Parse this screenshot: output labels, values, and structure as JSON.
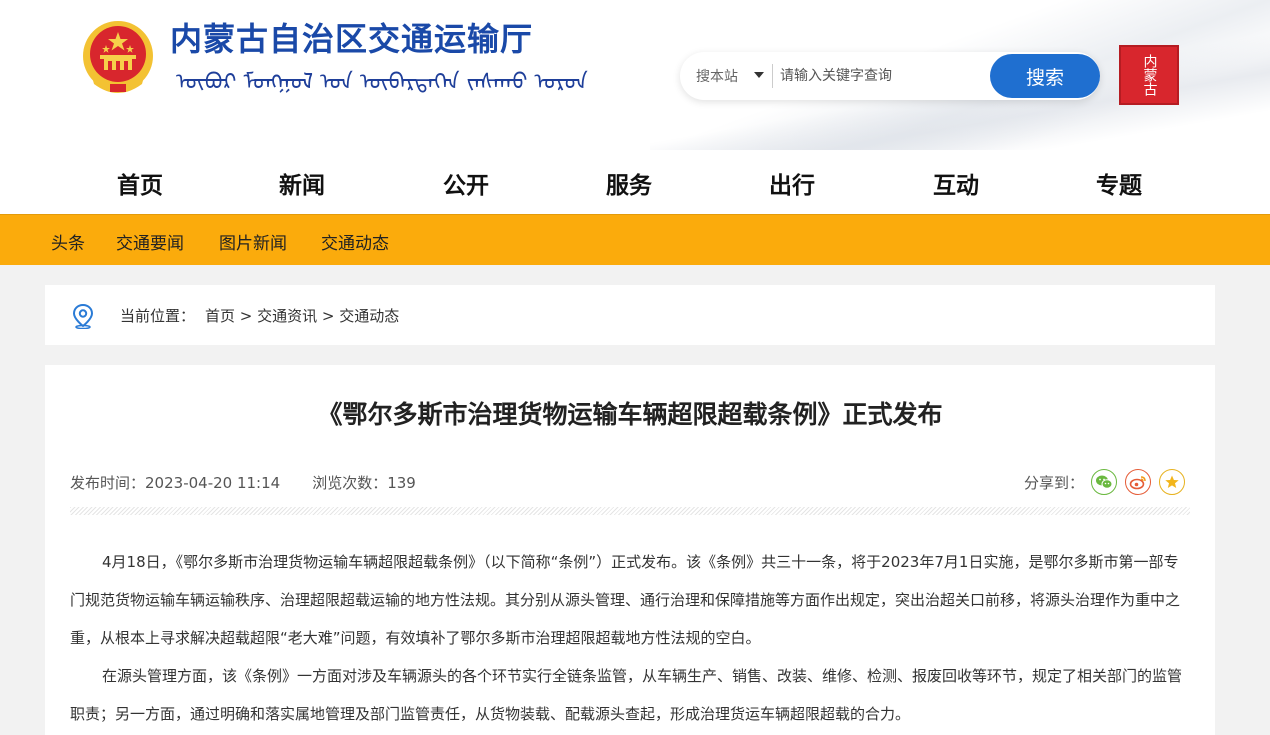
{
  "header": {
    "site_title": "内蒙古自治区交通运输厅",
    "mongolian_title": "ᠥᠪᠦᠷ ᠮᠣᠩᠭᠣᠯ ᠤᠨ ᠥᠪᠡᠷᠲᠡᠭᠡᠨ ᠵᠠᠰᠠᠬᠤ ᠣᠷᠤᠨ",
    "seal_text": "内蒙古",
    "colors": {
      "title": "#1a49a8",
      "search_button": "#1f6fd0",
      "seal": "#d8262d"
    }
  },
  "search": {
    "scope_label": "搜本站",
    "placeholder": "请输入关键字查询",
    "button_label": "搜索"
  },
  "main_nav": {
    "items": [
      "首页",
      "新闻",
      "公开",
      "服务",
      "出行",
      "互动",
      "专题"
    ]
  },
  "sub_nav": {
    "items": [
      "头条",
      "交通要闻",
      "图片新闻",
      "交通动态"
    ],
    "background": "#fbab0c"
  },
  "breadcrumb": {
    "label": "当前位置：",
    "items": [
      "首页",
      "交通资讯",
      "交通动态"
    ],
    "separator": " > "
  },
  "article": {
    "title": "《鄂尔多斯市治理货物运输车辆超限超载条例》正式发布",
    "publish_label": "发布时间：",
    "publish_time": "2023-04-20 11:14",
    "views_label": "浏览次数：",
    "views": "139",
    "share_label": "分享到：",
    "share_icons": [
      "wechat-icon",
      "weibo-icon",
      "favorite-star-icon"
    ],
    "paragraphs": [
      "4月18日，《鄂尔多斯市治理货物运输车辆超限超载条例》（以下简称“条例”）正式发布。该《条例》共三十一条，将于2023年7月1日实施，是鄂尔多斯市第一部专门规范货物运输车辆运输秩序、治理超限超载运输的地方性法规。其分别从源头管理、通行治理和保障措施等方面作出规定，突出治超关口前移，将源头治理作为重中之重，从根本上寻求解决超载超限“老大难”问题，有效填补了鄂尔多斯市治理超限超载地方性法规的空白。",
      "在源头管理方面，该《条例》一方面对涉及车辆源头的各个环节实行全链条监管，从车辆生产、销售、改装、维修、检测、报废回收等环节，规定了相关部门的监管职责；另一方面，通过明确和落实属地管理及部门监管责任，从货物装载、配载源头查起，形成治理货运车辆超限超载的合力。"
    ]
  }
}
